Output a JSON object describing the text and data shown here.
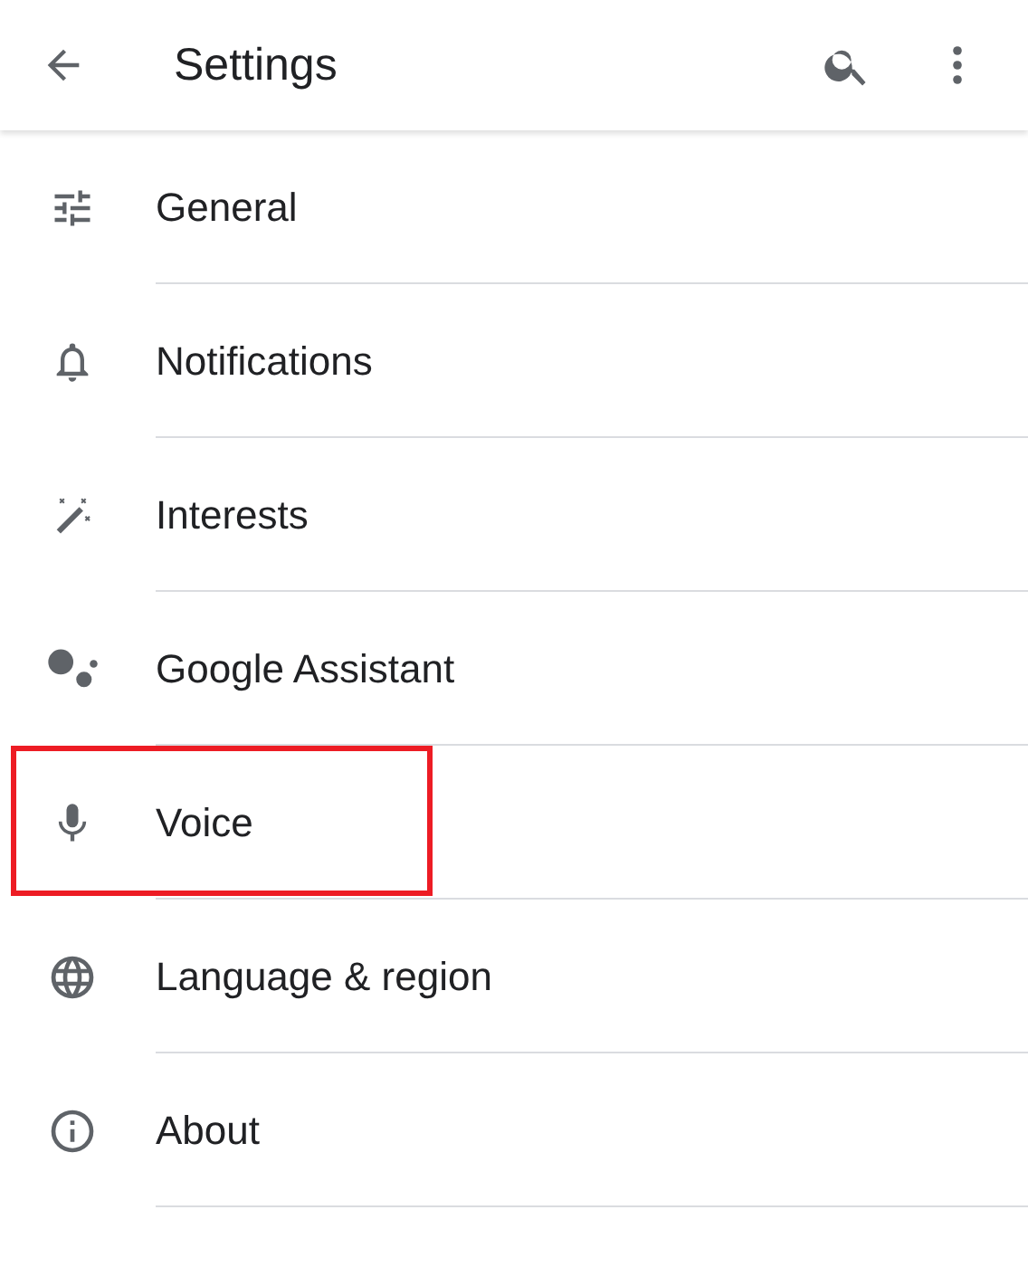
{
  "app_bar": {
    "title": "Settings"
  },
  "items": [
    {
      "label": "General",
      "kind": "sliders",
      "highlighted": false
    },
    {
      "label": "Notifications",
      "kind": "bell",
      "highlighted": false
    },
    {
      "label": "Interests",
      "kind": "wand",
      "highlighted": false
    },
    {
      "label": "Google Assistant",
      "kind": "dots",
      "highlighted": false
    },
    {
      "label": "Voice",
      "kind": "mic",
      "highlighted": true
    },
    {
      "label": "Language & region",
      "kind": "globe",
      "highlighted": false
    },
    {
      "label": "About",
      "kind": "info",
      "highlighted": false
    }
  ]
}
